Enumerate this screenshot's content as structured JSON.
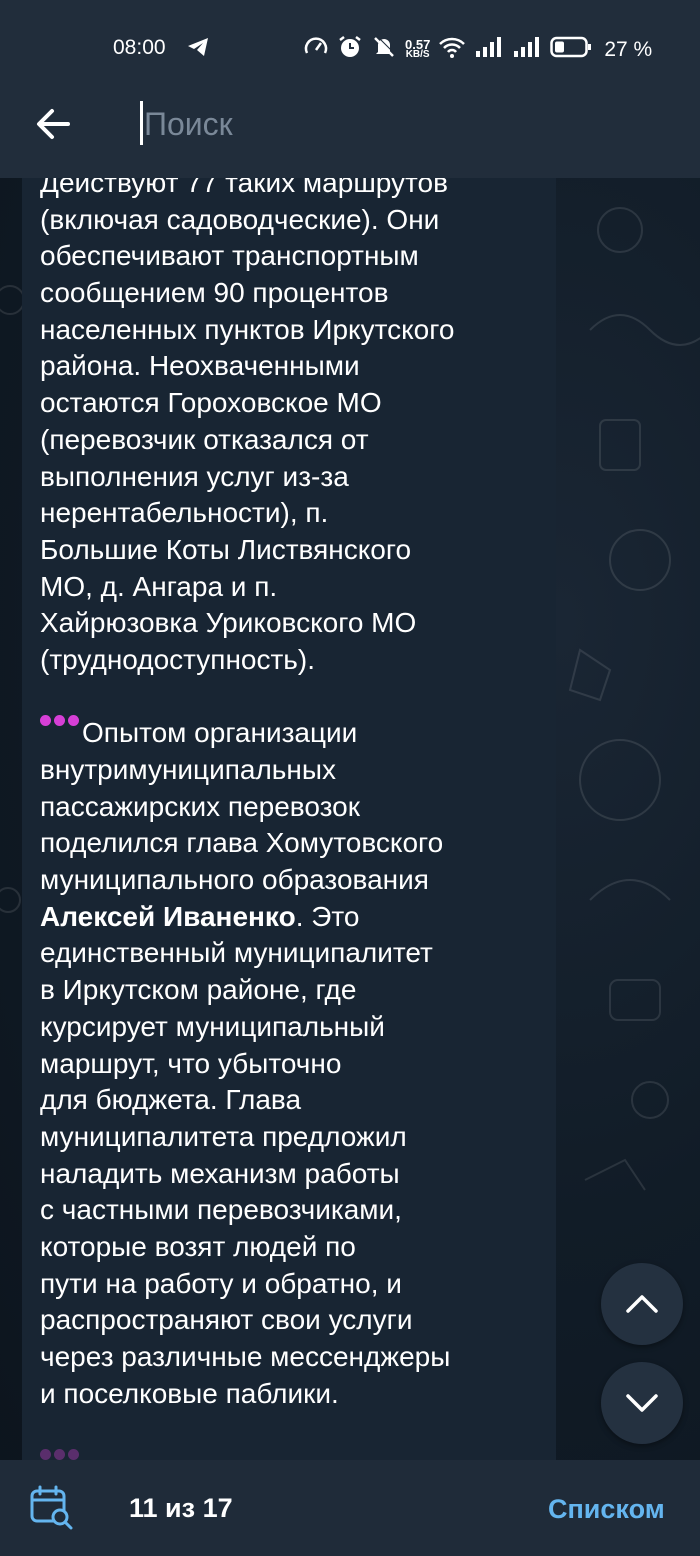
{
  "status_bar": {
    "time": "08:00",
    "net_speed_value": "0.57",
    "net_speed_unit": "KB/S",
    "battery_percent": "27 %"
  },
  "search": {
    "placeholder": "Поиск",
    "value": ""
  },
  "message": {
    "lines_1": [
      "Действуют 77 таких маршрутов",
      "(включая садоводческие). Они",
      "обеспечивают транспортным",
      "сообщением 90 процентов",
      "населенных пунктов Иркутского",
      "района. Неохваченными",
      "остаются Гороховское МО",
      "(перевозчик отказался от",
      "выполнения услуг из-за",
      "нерентабельности), п.",
      "Большие Коты Листвянского",
      "МО, д. Ангара и п.",
      "Хайрюзовка Уриковского МО",
      "(труднодоступность)."
    ],
    "p2_first": "Опытом организации",
    "lines_2a": [
      "внутримуниципальных",
      "пассажирских перевозок",
      "поделился глава Хомутовского",
      "муниципального образования"
    ],
    "bold_name": "Алексей Иваненко",
    "after_bold": ". Это",
    "lines_2b": [
      "единственный муниципалитет",
      "в Иркутском районе, где",
      "курсирует  муниципальный",
      "маршрут, что убыточно",
      "для бюджета. Глава",
      "муниципалитета предложил",
      "наладить механизм работы",
      "с частными перевозчиками,",
      "которые возят людей по",
      "пути на работу и обратно, и",
      "распространяют свои услуги",
      "через различные мессенджеры",
      "и поселковые паблики."
    ],
    "dots_color": "#d63fd6"
  },
  "search_nav": {
    "up_icon": "chevron-up-icon",
    "down_icon": "chevron-down-icon"
  },
  "bottom_bar": {
    "calendar_icon": "calendar-search-icon",
    "counter": "11 из 17",
    "list_label": "Списком",
    "accent": "#64b5ef"
  },
  "colors": {
    "header_bg": "#212d3b",
    "bubble_bg": "#182533",
    "chat_bg": "#0e1621"
  }
}
